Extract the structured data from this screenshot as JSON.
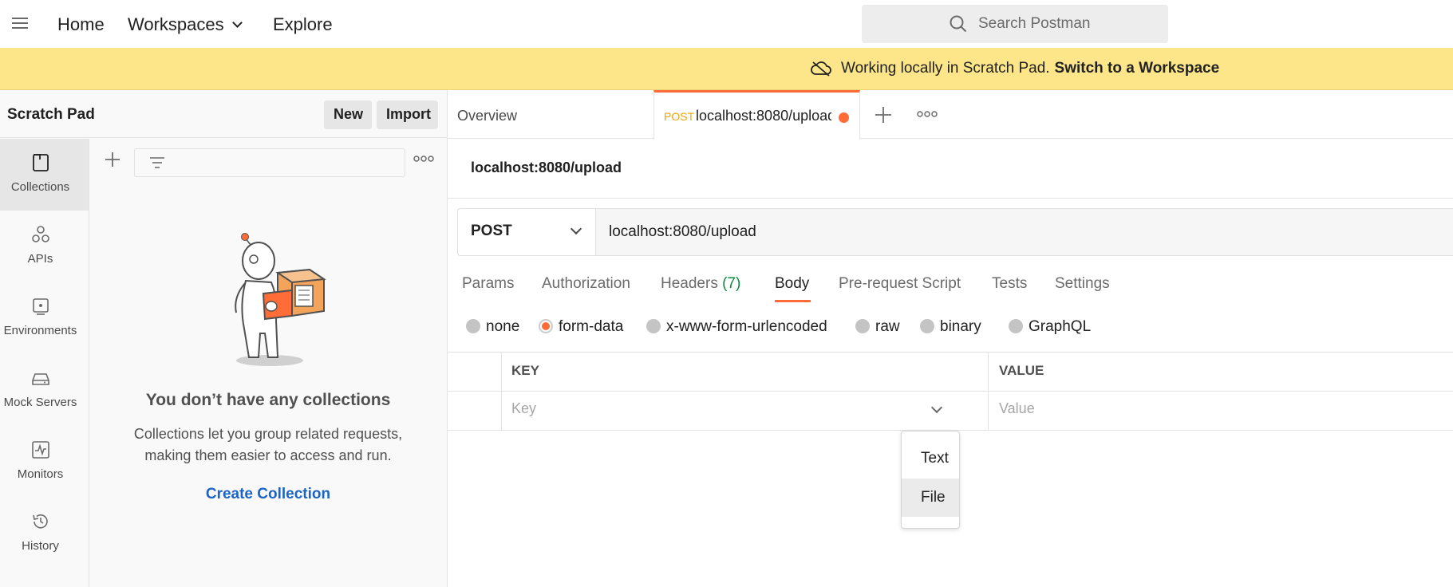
{
  "topbar": {
    "nav": {
      "home": "Home",
      "workspaces": "Workspaces",
      "explore": "Explore"
    },
    "search_placeholder": "Search Postman"
  },
  "banner": {
    "text": "Working locally in Scratch Pad.",
    "link": "Switch to a Workspace"
  },
  "sidebar": {
    "title": "Scratch Pad",
    "new_label": "New",
    "import_label": "Import",
    "rail": [
      {
        "label": "Collections",
        "icon": "collections-icon"
      },
      {
        "label": "APIs",
        "icon": "apis-icon"
      },
      {
        "label": "Environments",
        "icon": "environments-icon"
      },
      {
        "label": "Mock Servers",
        "icon": "mock-servers-icon"
      },
      {
        "label": "Monitors",
        "icon": "monitors-icon"
      },
      {
        "label": "History",
        "icon": "history-icon"
      }
    ],
    "empty": {
      "title": "You don’t have any collections",
      "description": "Collections let you group related requests, making them easier to access and run.",
      "cta": "Create Collection"
    }
  },
  "tabs": {
    "overview": "Overview",
    "active": {
      "method": "POST",
      "title": "localhost:8080/upload"
    }
  },
  "request": {
    "name": "localhost:8080/upload",
    "method": "POST",
    "url": "localhost:8080/upload",
    "tabs": {
      "params": "Params",
      "authorization": "Authorization",
      "headers": "Headers",
      "headers_count": "(7)",
      "body": "Body",
      "prerequest": "Pre-request Script",
      "tests": "Tests",
      "settings": "Settings"
    },
    "body_types": {
      "none": "none",
      "form_data": "form-data",
      "urlencoded": "x-www-form-urlencoded",
      "raw": "raw",
      "binary": "binary",
      "graphql": "GraphQL"
    },
    "selected_body_type": "form-data",
    "table": {
      "key_header": "KEY",
      "value_header": "VALUE",
      "key_placeholder": "Key",
      "value_placeholder": "Value"
    },
    "type_dropdown": {
      "text": "Text",
      "file": "File"
    }
  },
  "colors": {
    "accent": "#ff6c37",
    "banner": "#fde68a",
    "link": "#1c64c5",
    "headers_count": "#0a8a3a"
  }
}
